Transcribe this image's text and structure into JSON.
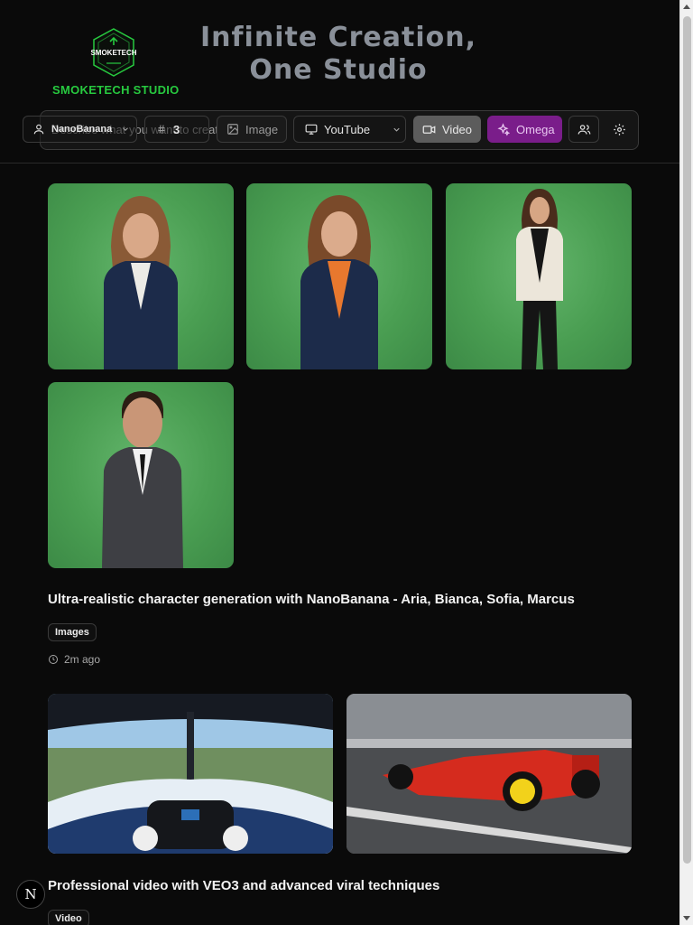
{
  "brand": {
    "name": "SMOKETECH STUDIO",
    "logo_text": "SMOKETECH"
  },
  "hero": {
    "line1": "Infinite Creation,",
    "line2": "One Studio"
  },
  "toolbar": {
    "prompt_placeholder": "Describe what you want to create...",
    "model": "NanoBanana",
    "count": "3",
    "image_label": "Image",
    "platform": "YouTube",
    "video_label": "Video",
    "omega_label": "Omega"
  },
  "posts": [
    {
      "title": "Ultra-realistic character generation with NanoBanana - Aria, Bianca, Sofia, Marcus",
      "tag": "Images",
      "time": "2m ago"
    },
    {
      "title": "Professional video with VEO3 and advanced viral techniques",
      "tag": "Video"
    }
  ],
  "fab": {
    "label": "N"
  },
  "colors": {
    "accent_green": "#27c93f",
    "omega_purple": "#7a1d8a",
    "background": "#0a0a0a"
  }
}
